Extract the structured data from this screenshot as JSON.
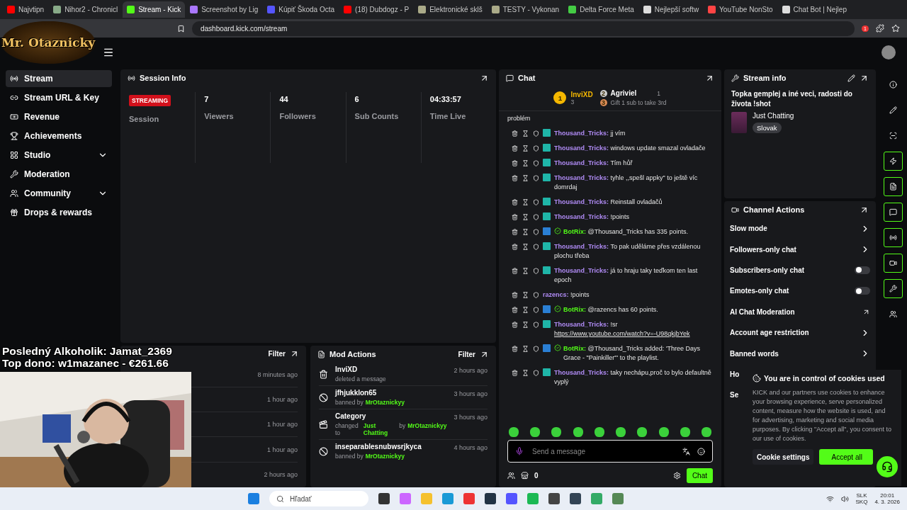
{
  "browser": {
    "tabs": [
      {
        "title": "Najvtipn",
        "selected": false
      },
      {
        "title": "Nihor2 - Chronicl",
        "selected": false
      },
      {
        "title": "Stream - Kick",
        "selected": true
      },
      {
        "title": "Screenshot by Lig",
        "selected": false
      },
      {
        "title": "Kúpiť Škoda Octa",
        "selected": false
      },
      {
        "title": "(18) Dubdogz - P",
        "selected": false
      },
      {
        "title": "Elektronické sklš",
        "selected": false
      },
      {
        "title": "TESTY - Vykonan",
        "selected": false
      },
      {
        "title": "Delta Force Meta",
        "selected": false
      },
      {
        "title": "Nejlepší softw",
        "selected": false
      },
      {
        "title": "YouTube NonSto",
        "selected": false
      },
      {
        "title": "Chat Bot | Nejlep",
        "selected": false
      }
    ],
    "url": "dashboard.kick.com/stream",
    "notification_count": "1"
  },
  "overlay": {
    "logo": "Mr. Otaznicky",
    "lines": [
      "Posledný Alkoholik: Jamat_2369",
      "Top dono: w1mazanec - €261.66"
    ]
  },
  "sidebar": {
    "items": [
      {
        "label": "Stream",
        "selected": true,
        "expandable": false
      },
      {
        "label": "Stream URL & Key",
        "selected": false,
        "expandable": false
      },
      {
        "label": "Revenue",
        "selected": false,
        "expandable": false
      },
      {
        "label": "Achievements",
        "selected": false,
        "expandable": false
      },
      {
        "label": "Studio",
        "selected": false,
        "expandable": true
      },
      {
        "label": "Moderation",
        "selected": false,
        "expandable": false
      },
      {
        "label": "Community",
        "selected": false,
        "expandable": true
      },
      {
        "label": "Drops & rewards",
        "selected": false,
        "expandable": false
      }
    ]
  },
  "session_info": {
    "title": "Session Info",
    "status": "STREAMING",
    "status_label": "Session",
    "stats": [
      {
        "value": "7",
        "label": "Viewers"
      },
      {
        "value": "44",
        "label": "Followers"
      },
      {
        "value": "6",
        "label": "Sub Counts"
      },
      {
        "value": "04:33:57",
        "label": "Time Live"
      }
    ]
  },
  "activity_feed": {
    "filter": "Filter",
    "times": [
      "8 minutes ago",
      "1 hour ago",
      "1 hour ago",
      "1 hour ago",
      "2 hours ago"
    ]
  },
  "mod_actions": {
    "title": "Mod Actions",
    "filter": "Filter",
    "items": [
      {
        "kind": "delete",
        "user": "InviXD",
        "time": "2 hours ago",
        "detail": [
          {
            "text": "deleted a message",
            "highlight": false
          }
        ]
      },
      {
        "kind": "ban",
        "user": "jfhjukklon65",
        "time": "3 hours ago",
        "detail": [
          {
            "text": "banned by",
            "highlight": false
          },
          {
            "text": "MrOtaznickyy",
            "highlight": true
          }
        ]
      },
      {
        "kind": "category",
        "user": "Category",
        "time": "3 hours ago",
        "detail": [
          {
            "text": "changed to",
            "highlight": false
          },
          {
            "text": "Just Chatting",
            "highlight": true
          },
          {
            "text": "by",
            "highlight": false
          },
          {
            "text": "MrOtaznickyy",
            "highlight": true
          }
        ]
      },
      {
        "kind": "ban",
        "user": "inseparablesnubwsrjkyca",
        "time": "4 hours ago",
        "detail": [
          {
            "text": "banned by",
            "highlight": false
          },
          {
            "text": "MrOtaznickyy",
            "highlight": true
          }
        ]
      }
    ]
  },
  "chat": {
    "title": "Chat",
    "leaders": [
      {
        "rank": "1",
        "name": "InviXD",
        "count": "3"
      },
      {
        "rank": "2",
        "name": "Agriviel",
        "count": "1"
      }
    ],
    "third": {
      "rank": "3",
      "text": "Gift 1 sub to take 3rd"
    },
    "messages": [
      {
        "kind": "continuation",
        "text": "problém"
      },
      {
        "kind": "user",
        "name": "Thousand_Tricks",
        "text": "jj vím"
      },
      {
        "kind": "user",
        "name": "Thousand_Tricks",
        "text": "windows update smazal ovladače"
      },
      {
        "kind": "user",
        "name": "Thousand_Tricks",
        "text": "Tím hůř"
      },
      {
        "kind": "user",
        "name": "Thousand_Tricks",
        "text": "tyhle ,,spešl appky\" to ještě víc domrdaj"
      },
      {
        "kind": "user",
        "name": "Thousand_Tricks",
        "text": "Reinstall ovladačů"
      },
      {
        "kind": "user",
        "name": "Thousand_Tricks",
        "text": "!points"
      },
      {
        "kind": "bot",
        "name": "BotRix",
        "text": "@Thousand_Tricks has 335 points."
      },
      {
        "kind": "user",
        "name": "Thousand_Tricks",
        "text": "To pak uděláme přes vzdálenou plochu třeba"
      },
      {
        "kind": "user",
        "name": "Thousand_Tricks",
        "text": "já to hraju taky teďkom ten last epoch"
      },
      {
        "kind": "plain",
        "name": "razencs",
        "text": "!points"
      },
      {
        "kind": "bot",
        "name": "BotRix",
        "text": "@razencs has 60 points."
      },
      {
        "kind": "user",
        "name": "Thousand_Tricks",
        "text": "!sr",
        "link": "https://www.youtube.com/watch?v=-U98qkjbYek"
      },
      {
        "kind": "bot",
        "name": "BotRix",
        "text": "@Thousand_Tricks added: 'Three Days Grace - \"Painkiller\"' to the playlist."
      },
      {
        "kind": "user",
        "name": "Thousand_Tricks",
        "text": "taky nechápu,proč to bylo defaultně vyplý"
      }
    ],
    "separator": ":",
    "input_placeholder": "Send a message",
    "points": "0",
    "send": "Chat"
  },
  "stream_info": {
    "title": "Stream info",
    "stream_title": "Topka gemplej a iné veci, radosti do života !shot",
    "category": "Just Chatting",
    "language": "Slovak"
  },
  "channel_actions": {
    "title": "Channel Actions",
    "items": [
      {
        "kind": "arrow",
        "label": "Slow mode"
      },
      {
        "kind": "arrow",
        "label": "Followers-only chat"
      },
      {
        "kind": "toggle",
        "label": "Subscribers-only chat",
        "on": false
      },
      {
        "kind": "toggle",
        "label": "Emotes-only chat",
        "on": false
      },
      {
        "kind": "external",
        "label": "AI Chat Moderation"
      },
      {
        "kind": "arrow",
        "label": "Account age restriction"
      },
      {
        "kind": "arrow",
        "label": "Banned words"
      },
      {
        "kind": "partial",
        "label": "Ho"
      },
      {
        "kind": "partial",
        "label": "Se"
      }
    ]
  },
  "rail": [
    {
      "highlighted": false
    },
    {
      "highlighted": false
    },
    {
      "highlighted": false
    },
    {
      "highlighted": true
    },
    {
      "highlighted": true
    },
    {
      "highlighted": true
    },
    {
      "highlighted": true
    },
    {
      "highlighted": true
    },
    {
      "highlighted": true
    },
    {
      "highlighted": false
    }
  ],
  "cookies": {
    "title": "You are in control of cookies used",
    "body": "KICK and our partners use cookies to enhance your browsing experience, serve personalized content, measure how the website is used, and for advertising, marketing and social media purposes. By clicking \"Accept all\", you consent to our use of cookies.",
    "settings": "Cookie settings",
    "accept": "Accept all"
  },
  "taskbar": {
    "search": "Hľadať",
    "lang_top": "SLK",
    "lang_bottom": "SKQ",
    "time": "20:01",
    "date": "4. 3. 2026"
  }
}
